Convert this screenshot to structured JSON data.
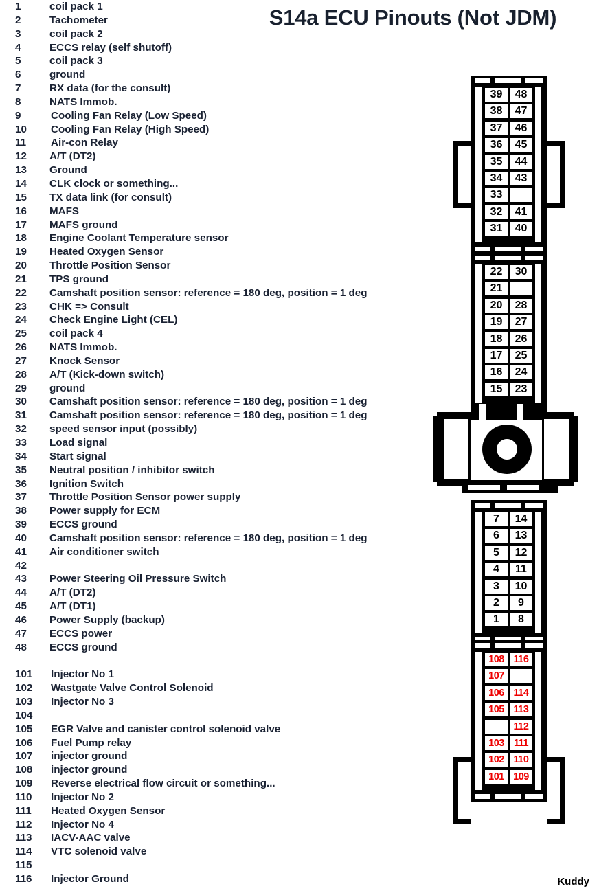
{
  "title": "S14a ECU Pinouts (Not JDM)",
  "signature": "Kuddy",
  "colors": {
    "text": "#1a2233",
    "title": "#18202e",
    "pin_number_black": "#000000",
    "pin_number_red": "#ee0000",
    "connector_body": "#000000",
    "background": "#ffffff"
  },
  "pin_list": [
    {
      "num": "1",
      "desc": "coil pack 1"
    },
    {
      "num": "2",
      "desc": "Tachometer"
    },
    {
      "num": "3",
      "desc": "coil pack 2"
    },
    {
      "num": "4",
      "desc": "ECCS relay (self shutoff)"
    },
    {
      "num": "5",
      "desc": "coil pack 3"
    },
    {
      "num": "6",
      "desc": "ground"
    },
    {
      "num": "7",
      "desc": "RX data (for the consult)"
    },
    {
      "num": "8",
      "desc": "NATS Immob."
    },
    {
      "num": "9",
      "desc": "Cooling Fan Relay (Low Speed)"
    },
    {
      "num": "10",
      "desc": "Cooling Fan Relay (High Speed)"
    },
    {
      "num": "11",
      "desc": "Air-con Relay"
    },
    {
      "num": "12",
      "desc": "A/T (DT2)"
    },
    {
      "num": "13",
      "desc": "Ground"
    },
    {
      "num": "14",
      "desc": "CLK clock or something..."
    },
    {
      "num": "15",
      "desc": "TX data link (for consult)"
    },
    {
      "num": "16",
      "desc": "MAFS"
    },
    {
      "num": "17",
      "desc": "MAFS ground"
    },
    {
      "num": "18",
      "desc": "Engine Coolant Temperature sensor"
    },
    {
      "num": "19",
      "desc": "Heated Oxygen Sensor"
    },
    {
      "num": "20",
      "desc": "Throttle Position Sensor"
    },
    {
      "num": "21",
      "desc": "TPS ground"
    },
    {
      "num": "22",
      "desc": "Camshaft position sensor: reference = 180 deg, position = 1 deg"
    },
    {
      "num": "23",
      "desc": "CHK => Consult"
    },
    {
      "num": "24",
      "desc": "Check Engine Light (CEL)"
    },
    {
      "num": "25",
      "desc": "coil pack 4"
    },
    {
      "num": "26",
      "desc": "NATS Immob."
    },
    {
      "num": "27",
      "desc": "Knock Sensor"
    },
    {
      "num": "28",
      "desc": "A/T (Kick-down switch)"
    },
    {
      "num": "29",
      "desc": "ground"
    },
    {
      "num": "30",
      "desc": "Camshaft position sensor: reference = 180 deg, position = 1 deg"
    },
    {
      "num": "31",
      "desc": "Camshaft position sensor: reference = 180 deg, position = 1 deg"
    },
    {
      "num": "32",
      "desc": "speed sensor input (possibly)"
    },
    {
      "num": "33",
      "desc": "Load signal"
    },
    {
      "num": "34",
      "desc": "Start signal"
    },
    {
      "num": "35",
      "desc": "Neutral position / inhibitor switch"
    },
    {
      "num": "36",
      "desc": "Ignition Switch"
    },
    {
      "num": "37",
      "desc": "Throttle Position Sensor power supply"
    },
    {
      "num": "38",
      "desc": "Power supply for ECM"
    },
    {
      "num": "39",
      "desc": "ECCS ground"
    },
    {
      "num": "40",
      "desc": "Camshaft position sensor: reference = 180 deg, position = 1 deg"
    },
    {
      "num": "41",
      "desc": "Air conditioner switch"
    },
    {
      "num": "42",
      "desc": ""
    },
    {
      "num": "43",
      "desc": "Power Steering Oil Pressure Switch"
    },
    {
      "num": "44",
      "desc": "A/T (DT2)"
    },
    {
      "num": "45",
      "desc": "A/T (DT1)"
    },
    {
      "num": "46",
      "desc": "Power Supply (backup)"
    },
    {
      "num": "47",
      "desc": "ECCS power"
    },
    {
      "num": "48",
      "desc": "ECCS ground"
    },
    {
      "num": "",
      "desc": ""
    },
    {
      "num": "101",
      "desc": "Injector No 1"
    },
    {
      "num": "102",
      "desc": "Wastgate Valve Control Solenoid"
    },
    {
      "num": "103",
      "desc": "Injector No 3"
    },
    {
      "num": "104",
      "desc": ""
    },
    {
      "num": "105",
      "desc": "EGR Valve and canister control solenoid valve"
    },
    {
      "num": "106",
      "desc": "Fuel Pump relay"
    },
    {
      "num": "107",
      "desc": "injector ground"
    },
    {
      "num": "108",
      "desc": "injector ground"
    },
    {
      "num": "109",
      "desc": "Reverse electrical flow circuit or something..."
    },
    {
      "num": "110",
      "desc": "Injector No 2"
    },
    {
      "num": "111",
      "desc": "Heated Oxygen Sensor"
    },
    {
      "num": "112",
      "desc": "Injector No 4"
    },
    {
      "num": "113",
      "desc": "IACV-AAC valve"
    },
    {
      "num": "114",
      "desc": "VTC solenoid valve"
    },
    {
      "num": "115",
      "desc": ""
    },
    {
      "num": "116",
      "desc": "Injector Ground"
    }
  ],
  "connectors": [
    {
      "id": "connector-48pin-top",
      "color": "black",
      "left_column": [
        "39",
        "38",
        "37",
        "36",
        "35",
        "34",
        "33",
        "32",
        "31"
      ],
      "right_column": [
        "48",
        "47",
        "46",
        "45",
        "44",
        "43",
        "",
        "41",
        "40"
      ]
    },
    {
      "id": "connector-30pin-middle",
      "color": "black",
      "left_column": [
        "22",
        "21",
        "20",
        "19",
        "18",
        "17",
        "16",
        "15"
      ],
      "right_column": [
        "30",
        "",
        "28",
        "27",
        "26",
        "25",
        "24",
        "23"
      ]
    },
    {
      "id": "connector-14pin-lower",
      "color": "black",
      "left_column": [
        "7",
        "6",
        "5",
        "4",
        "3",
        "2",
        "1"
      ],
      "right_column": [
        "14",
        "13",
        "12",
        "11",
        "10",
        "9",
        "8"
      ]
    },
    {
      "id": "connector-116pin-bottom",
      "color": "red",
      "left_column": [
        "108",
        "107",
        "106",
        "105",
        "",
        "103",
        "102",
        "101"
      ],
      "right_column": [
        "116",
        "",
        "114",
        "113",
        "112",
        "111",
        "110",
        "109"
      ]
    }
  ]
}
